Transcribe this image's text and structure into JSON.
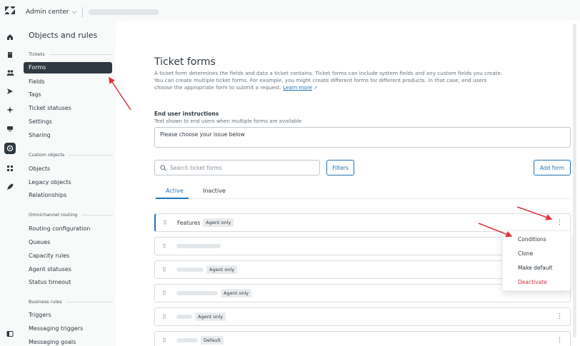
{
  "topbar": {
    "product": "Admin center",
    "chevron_icon": "chevron-down-icon"
  },
  "rail_icons": [
    "home-icon",
    "building-icon",
    "people-icon",
    "channels-icon",
    "sparkle-icon",
    "workspace-icon",
    "objects-icon",
    "apps-icon",
    "rocket-icon",
    "panel-icon"
  ],
  "nav": {
    "title": "Objects and rules",
    "sections": [
      {
        "label": "Tickets",
        "items": [
          "Forms",
          "Fields",
          "Tags",
          "Ticket statuses",
          "Settings",
          "Sharing"
        ]
      },
      {
        "label": "Custom objects",
        "items": [
          "Objects",
          "Legacy objects",
          "Relationships"
        ]
      },
      {
        "label": "Omnichannel routing",
        "items": [
          "Routing configuration",
          "Queues",
          "Capacity rules",
          "Agent statuses",
          "Status timeout"
        ]
      },
      {
        "label": "Business rules",
        "items": [
          "Triggers",
          "Messaging triggers",
          "Messaging goals"
        ]
      }
    ],
    "active_item": "Forms"
  },
  "main": {
    "title": "Ticket forms",
    "description": "A ticket form determines the fields and data a ticket contains. Ticket forms can include system fields and any custom fields you create. You can create multiple ticket forms. For example, you might create different forms for different products. In that case, end users choose the appropriate form to submit a request.",
    "learn_more": "Learn more",
    "end_user_instructions": {
      "label": "End user instructions",
      "hint": "Text shown to end users when multiple forms are available",
      "value": "Please choose your issue below"
    },
    "search_placeholder": "Search ticket forms",
    "filters_label": "Filters",
    "add_form_label": "Add form",
    "tabs": [
      "Active",
      "Inactive"
    ],
    "active_tab": "Active",
    "rows": [
      {
        "name": "Features",
        "tag": "Agent only"
      },
      {
        "name": "",
        "tag": ""
      },
      {
        "name": "",
        "tag": "Agent only"
      },
      {
        "name": "",
        "tag": "Agent only"
      },
      {
        "name": "",
        "tag": "Agent only"
      },
      {
        "name": "",
        "tag": "Default"
      }
    ],
    "row_menu": [
      "Conditions",
      "Clone",
      "Make default",
      "Deactivate"
    ]
  },
  "colors": {
    "accent": "#1f73b7",
    "danger": "#cc3340",
    "annotation_arrow": "#e0323a",
    "nav_active": "#2f3941"
  }
}
